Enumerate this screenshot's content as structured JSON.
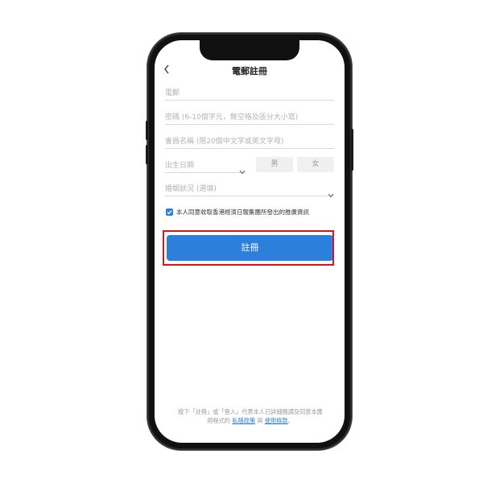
{
  "header": {
    "title": "電郵註冊",
    "back_icon": "chevron-left-icon"
  },
  "form": {
    "email_placeholder": "電郵",
    "password_placeholder": "密碼 (6-10個字元，無空格及區分大小寫)",
    "nickname_placeholder": "會員名稱 (限20個中文字或英文字母)",
    "birthdate_placeholder": "出生日期",
    "gender_male": "男",
    "gender_female": "女",
    "marital_placeholder": "婚姻狀況 (選填)",
    "consent_checked": true,
    "consent_text": "本人同意收取香港經濟日報集團所發出的推廣資訊",
    "register_label": "註冊"
  },
  "footer": {
    "line1": "按下「註冊」或「登入」代表本人已詳細閱讀及同意本應",
    "line2_prefix": "用程式的",
    "privacy_link": "私隱政策",
    "and_text": "與",
    "terms_link": "使用條款",
    "suffix": "。"
  },
  "colors": {
    "accent": "#2d7fdc",
    "highlight": "#e0101e"
  }
}
